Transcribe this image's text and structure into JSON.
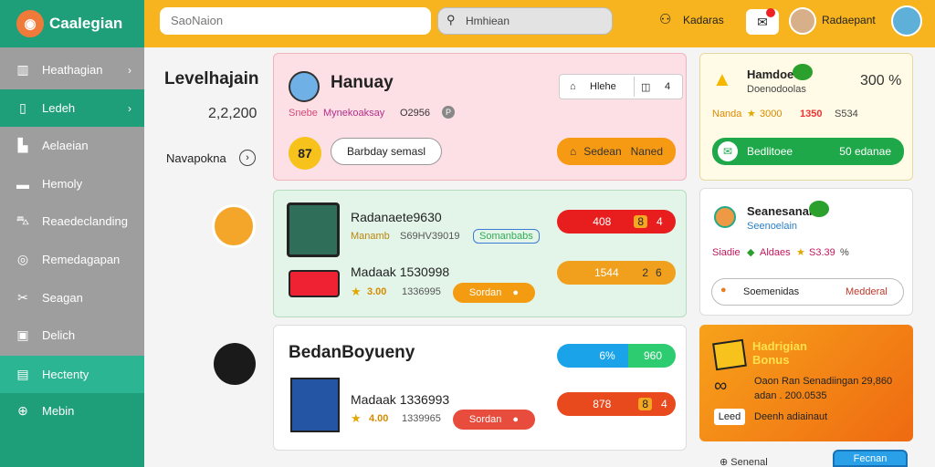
{
  "app": {
    "title": "Caalegian"
  },
  "sidebar": {
    "items": [
      {
        "label": "Heathagian",
        "icon": "grid-icon"
      },
      {
        "label": "Ledeh",
        "icon": "book-icon"
      },
      {
        "label": "Aelaeian",
        "icon": "chart-icon"
      },
      {
        "label": "Hemoly",
        "icon": "folder-icon"
      },
      {
        "label": "Reaedeclanding",
        "icon": "car-icon"
      },
      {
        "label": "Remedagapan",
        "icon": "compass-icon"
      },
      {
        "label": "Seagan",
        "icon": "tools-icon"
      },
      {
        "label": "Delich",
        "icon": "bag-icon"
      },
      {
        "label": "Hectenty",
        "icon": "list-icon"
      },
      {
        "label": "Mebin",
        "icon": "globe-icon"
      }
    ]
  },
  "header": {
    "search_placeholder": "SaoNaion",
    "search2_placeholder": "Hmhiean",
    "user_label": "Kadaras",
    "profile_name": "Radaepant"
  },
  "left": {
    "level_title": "Levelhajain",
    "level_value": "2,2,200",
    "link_label": "Navapokna"
  },
  "card1": {
    "title": "Hanuay",
    "tag1": "Snebe",
    "tag2": "Mynekoaksay",
    "code": "O2956",
    "btn_a": "Hlehe",
    "btn_b": "4",
    "badge": "87",
    "action1": "Barbday semasl",
    "action2": "Sedean",
    "action2b": "Naned"
  },
  "card2": {
    "row1_title": "Radanaete9630",
    "row1_tag": "Manamb",
    "row1_code": "S69HV39019",
    "row1_link": "Somanbabs",
    "row1_pill_a": "408",
    "row1_pill_b": "8",
    "row1_pill_c": "4",
    "row2_title": "Madaak 1530998",
    "row2_score": "3.00",
    "row2_code": "1336995",
    "row2_btn": "Sordan",
    "row2_pill_a": "1544",
    "row2_pill_b": "2",
    "row2_pill_c": "6"
  },
  "card3": {
    "title": "BedanBoyueny",
    "pill1_a": "6%",
    "pill1_b": "960",
    "row_title": "Madaak 1336993",
    "row_score": "4.00",
    "row_code": "1339965",
    "row_btn": "Sordan",
    "pill2_a": "878",
    "pill2_b": "8",
    "pill2_c": "4"
  },
  "right1": {
    "title": "Hamdoe",
    "subtitle": "Doenodoolas",
    "percent": "300 %",
    "stat_label": "Nanda",
    "stat1": "3000",
    "stat2": "1350",
    "stat3": "S534",
    "button": "Bedlitoee",
    "button_value": "50 edanae"
  },
  "right2": {
    "title": "Seanesanan",
    "subtitle": "Seenoelain",
    "stat_label": "Siadie",
    "stat1": "Aldaes",
    "stat2": "S3.39",
    "stat3": "%",
    "input_label": "Soemenidas",
    "input_value": "Medderal"
  },
  "right3": {
    "title": "Hadrigian Bonus",
    "line1": "Oaon Ran Senadiingan 29,860",
    "line2": "adan . 200.0535",
    "btn_a": "Leed",
    "btn_b": "Deenh adiainaut"
  },
  "footer": {
    "link": "Senenal",
    "button": "Fecnan"
  }
}
